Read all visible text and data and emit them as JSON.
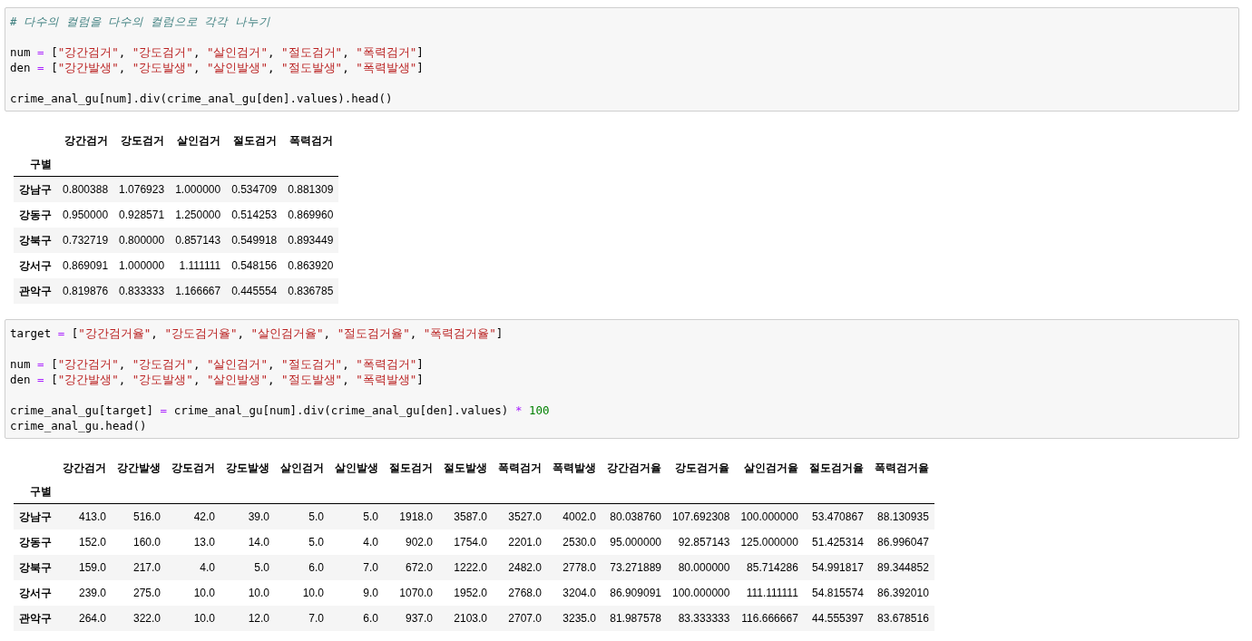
{
  "cells": [
    {
      "kind": "code",
      "blocks": [
        [
          [
            {
              "kind": "comment",
              "t": "# 다수의 컬럼을 다수의 컬럼으로 각각 나누기"
            }
          ]
        ],
        [
          [
            {
              "kind": "name",
              "t": "num "
            },
            {
              "kind": "op",
              "t": "="
            },
            {
              "kind": "name",
              "t": " ["
            },
            {
              "kind": "str",
              "t": "\"강간검거\""
            },
            {
              "kind": "name",
              "t": ", "
            },
            {
              "kind": "str",
              "t": "\"강도검거\""
            },
            {
              "kind": "name",
              "t": ", "
            },
            {
              "kind": "str",
              "t": "\"살인검거\""
            },
            {
              "kind": "name",
              "t": ", "
            },
            {
              "kind": "str",
              "t": "\"절도검거\""
            },
            {
              "kind": "name",
              "t": ", "
            },
            {
              "kind": "str",
              "t": "\"폭력검거\""
            },
            {
              "kind": "name",
              "t": "]"
            }
          ],
          [
            {
              "kind": "name",
              "t": "den "
            },
            {
              "kind": "op",
              "t": "="
            },
            {
              "kind": "name",
              "t": " ["
            },
            {
              "kind": "str",
              "t": "\"강간발생\""
            },
            {
              "kind": "name",
              "t": ", "
            },
            {
              "kind": "str",
              "t": "\"강도발생\""
            },
            {
              "kind": "name",
              "t": ", "
            },
            {
              "kind": "str",
              "t": "\"살인발생\""
            },
            {
              "kind": "name",
              "t": ", "
            },
            {
              "kind": "str",
              "t": "\"절도발생\""
            },
            {
              "kind": "name",
              "t": ", "
            },
            {
              "kind": "str",
              "t": "\"폭력발생\""
            },
            {
              "kind": "name",
              "t": "]"
            }
          ]
        ],
        [
          [
            {
              "kind": "name",
              "t": "crime_anal_gu[num].div(crime_anal_gu[den].values).head()"
            }
          ]
        ]
      ]
    },
    {
      "kind": "table",
      "index_name": "구별",
      "columns": [
        "강간검거",
        "강도검거",
        "살인검거",
        "절도검거",
        "폭력검거"
      ],
      "rows": [
        {
          "index": "강남구",
          "values": [
            "0.800388",
            "1.076923",
            "1.000000",
            "0.534709",
            "0.881309"
          ]
        },
        {
          "index": "강동구",
          "values": [
            "0.950000",
            "0.928571",
            "1.250000",
            "0.514253",
            "0.869960"
          ]
        },
        {
          "index": "강북구",
          "values": [
            "0.732719",
            "0.800000",
            "0.857143",
            "0.549918",
            "0.893449"
          ]
        },
        {
          "index": "강서구",
          "values": [
            "0.869091",
            "1.000000",
            "1.111111",
            "0.548156",
            "0.863920"
          ]
        },
        {
          "index": "관악구",
          "values": [
            "0.819876",
            "0.833333",
            "1.166667",
            "0.445554",
            "0.836785"
          ]
        }
      ]
    },
    {
      "kind": "code",
      "blocks": [
        [
          [
            {
              "kind": "name",
              "t": "target "
            },
            {
              "kind": "op",
              "t": "="
            },
            {
              "kind": "name",
              "t": " ["
            },
            {
              "kind": "str",
              "t": "\"강간검거율\""
            },
            {
              "kind": "name",
              "t": ", "
            },
            {
              "kind": "str",
              "t": "\"강도검거율\""
            },
            {
              "kind": "name",
              "t": ", "
            },
            {
              "kind": "str",
              "t": "\"살인검거율\""
            },
            {
              "kind": "name",
              "t": ", "
            },
            {
              "kind": "str",
              "t": "\"절도검거율\""
            },
            {
              "kind": "name",
              "t": ", "
            },
            {
              "kind": "str",
              "t": "\"폭력검거율\""
            },
            {
              "kind": "name",
              "t": "]"
            }
          ]
        ],
        [
          [
            {
              "kind": "name",
              "t": "num "
            },
            {
              "kind": "op",
              "t": "="
            },
            {
              "kind": "name",
              "t": " ["
            },
            {
              "kind": "str",
              "t": "\"강간검거\""
            },
            {
              "kind": "name",
              "t": ", "
            },
            {
              "kind": "str",
              "t": "\"강도검거\""
            },
            {
              "kind": "name",
              "t": ", "
            },
            {
              "kind": "str",
              "t": "\"살인검거\""
            },
            {
              "kind": "name",
              "t": ", "
            },
            {
              "kind": "str",
              "t": "\"절도검거\""
            },
            {
              "kind": "name",
              "t": ", "
            },
            {
              "kind": "str",
              "t": "\"폭력검거\""
            },
            {
              "kind": "name",
              "t": "]"
            }
          ],
          [
            {
              "kind": "name",
              "t": "den "
            },
            {
              "kind": "op",
              "t": "="
            },
            {
              "kind": "name",
              "t": " ["
            },
            {
              "kind": "str",
              "t": "\"강간발생\""
            },
            {
              "kind": "name",
              "t": ", "
            },
            {
              "kind": "str",
              "t": "\"강도발생\""
            },
            {
              "kind": "name",
              "t": ", "
            },
            {
              "kind": "str",
              "t": "\"살인발생\""
            },
            {
              "kind": "name",
              "t": ", "
            },
            {
              "kind": "str",
              "t": "\"절도발생\""
            },
            {
              "kind": "name",
              "t": ", "
            },
            {
              "kind": "str",
              "t": "\"폭력발생\""
            },
            {
              "kind": "name",
              "t": "]"
            }
          ]
        ],
        [
          [
            {
              "kind": "name",
              "t": "crime_anal_gu[target] "
            },
            {
              "kind": "op",
              "t": "="
            },
            {
              "kind": "name",
              "t": " crime_anal_gu[num].div(crime_anal_gu[den].values) "
            },
            {
              "kind": "op",
              "t": "* "
            },
            {
              "kind": "num",
              "t": "100"
            }
          ],
          [
            {
              "kind": "name",
              "t": "crime_anal_gu.head()"
            }
          ]
        ]
      ]
    },
    {
      "kind": "table",
      "index_name": "구별",
      "columns": [
        "강간검거",
        "강간발생",
        "강도검거",
        "강도발생",
        "살인검거",
        "살인발생",
        "절도검거",
        "절도발생",
        "폭력검거",
        "폭력발생",
        "강간검거율",
        "강도검거율",
        "살인검거율",
        "절도검거율",
        "폭력검거율"
      ],
      "rows": [
        {
          "index": "강남구",
          "values": [
            "413.0",
            "516.0",
            "42.0",
            "39.0",
            "5.0",
            "5.0",
            "1918.0",
            "3587.0",
            "3527.0",
            "4002.0",
            "80.038760",
            "107.692308",
            "100.000000",
            "53.470867",
            "88.130935"
          ]
        },
        {
          "index": "강동구",
          "values": [
            "152.0",
            "160.0",
            "13.0",
            "14.0",
            "5.0",
            "4.0",
            "902.0",
            "1754.0",
            "2201.0",
            "2530.0",
            "95.000000",
            "92.857143",
            "125.000000",
            "51.425314",
            "86.996047"
          ]
        },
        {
          "index": "강북구",
          "values": [
            "159.0",
            "217.0",
            "4.0",
            "5.0",
            "6.0",
            "7.0",
            "672.0",
            "1222.0",
            "2482.0",
            "2778.0",
            "73.271889",
            "80.000000",
            "85.714286",
            "54.991817",
            "89.344852"
          ]
        },
        {
          "index": "강서구",
          "values": [
            "239.0",
            "275.0",
            "10.0",
            "10.0",
            "10.0",
            "9.0",
            "1070.0",
            "1952.0",
            "2768.0",
            "3204.0",
            "86.909091",
            "100.000000",
            "111.111111",
            "54.815574",
            "86.392010"
          ]
        },
        {
          "index": "관악구",
          "values": [
            "264.0",
            "322.0",
            "10.0",
            "12.0",
            "7.0",
            "6.0",
            "937.0",
            "2103.0",
            "2707.0",
            "3235.0",
            "81.987578",
            "83.333333",
            "116.666667",
            "44.555397",
            "83.678516"
          ]
        }
      ]
    }
  ]
}
